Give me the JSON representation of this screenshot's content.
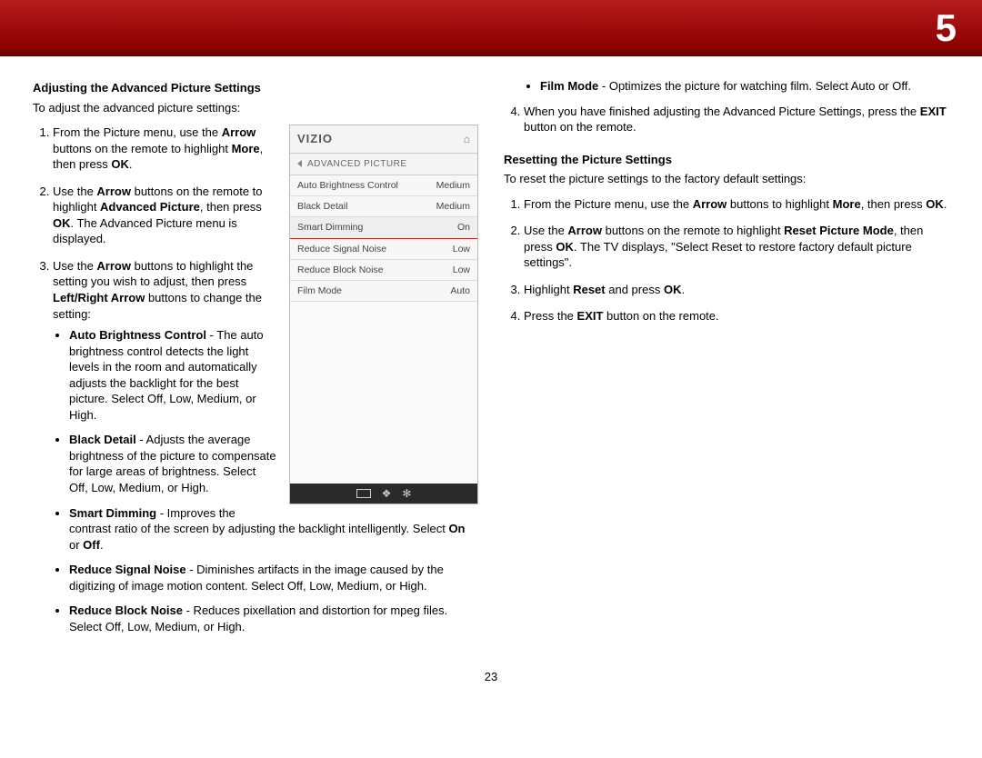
{
  "chapter_number": "5",
  "page_number": "23",
  "left": {
    "heading": "Adjusting the Advanced Picture Settings",
    "intro": "To adjust the advanced picture settings:",
    "step1_a": "From the Picture menu, use the ",
    "step1_b": "Arrow",
    "step1_c": " buttons on the remote to highlight ",
    "step1_d": "More",
    "step1_e": ", then press ",
    "step1_f": "OK",
    "step1_g": ".",
    "step2_a": "Use the ",
    "step2_b": "Arrow",
    "step2_c": " buttons on the remote to highlight ",
    "step2_d": "Advanced Picture",
    "step2_e": ", then press ",
    "step2_f": "OK",
    "step2_g": ". The Advanced Picture menu is displayed.",
    "step3_a": "Use the ",
    "step3_b": "Arrow",
    "step3_c": " buttons to highlight the setting you wish to adjust, then press ",
    "step3_d": "Left/Right Arrow",
    "step3_e": " buttons to change the setting:",
    "b_abc_t": "Auto Brightness Control",
    "b_abc_d": " - The auto brightness control detects the light levels in the room and automatically adjusts the backlight for the best picture. Select Off, Low, Medium, or High.",
    "b_bd_t": "Black Detail",
    "b_bd_d": " - Adjusts the average brightness of the picture to compensate for large areas of brightness. Select Off, Low, Medium, or High.",
    "b_sd_t": "Smart Dimming",
    "b_sd_d_a": " - Improves the contrast ratio of the screen by adjusting the backlight intelligently. Select ",
    "b_sd_on": "On",
    "b_sd_d_b": " or ",
    "b_sd_off": "Off",
    "b_sd_d_c": ".",
    "b_rsn_t": "Reduce Signal Noise",
    "b_rsn_d": " - Diminishes artifacts in the image caused by the digitizing of image motion content. Select Off, Low, Medium, or High.",
    "b_rbn_t": "Reduce Block Noise",
    "b_rbn_d": " - Reduces pixellation and distortion for mpeg files. Select Off, Low, Medium, or High."
  },
  "right": {
    "b_fm_t": "Film Mode",
    "b_fm_d": " - Optimizes the picture for watching film. Select Auto or Off.",
    "step4_a": "When you have finished adjusting the Advanced Picture Settings, press the ",
    "step4_b": "EXIT",
    "step4_c": " button on the remote.",
    "heading2": "Resetting the Picture Settings",
    "intro2": "To reset the picture settings to the factory default settings:",
    "r_step1_a": "From the Picture menu, use the ",
    "r_step1_b": "Arrow",
    "r_step1_c": " buttons to highlight ",
    "r_step1_d": "More",
    "r_step1_e": ", then press ",
    "r_step1_f": "OK",
    "r_step1_g": ".",
    "r_step2_a": "Use the ",
    "r_step2_b": "Arrow",
    "r_step2_c": " buttons on the remote to highlight ",
    "r_step2_d": "Reset Picture Mode",
    "r_step2_e": ", then press ",
    "r_step2_f": "OK",
    "r_step2_g": ". The TV displays, \"Select Reset to restore factory default picture settings\".",
    "r_step3_a": "Highlight ",
    "r_step3_b": "Reset",
    "r_step3_c": " and press ",
    "r_step3_d": "OK",
    "r_step3_e": ".",
    "r_step4_a": "Press the ",
    "r_step4_b": "EXIT",
    "r_step4_c": " button on the remote."
  },
  "panel": {
    "brand": "VIZIO",
    "subtitle": "ADVANCED PICTURE",
    "rows": [
      {
        "label": "Auto Brightness Control",
        "value": "Medium"
      },
      {
        "label": "Black Detail",
        "value": "Medium"
      },
      {
        "label": "Smart Dimming",
        "value": "On"
      },
      {
        "label": "Reduce Signal Noise",
        "value": "Low"
      },
      {
        "label": "Reduce Block Noise",
        "value": "Low"
      },
      {
        "label": "Film Mode",
        "value": "Auto"
      }
    ]
  }
}
